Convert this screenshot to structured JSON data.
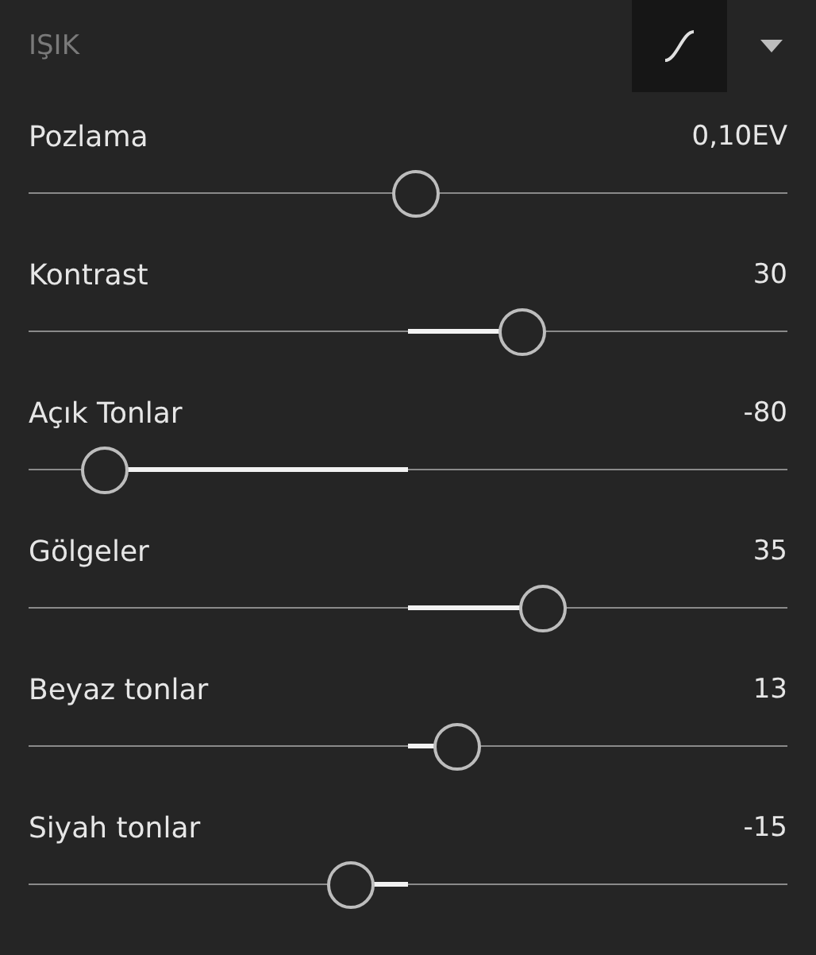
{
  "panel": {
    "title": "IŞIK",
    "curve_button": {
      "selected": true
    }
  },
  "sliders": [
    {
      "label": "Pozlama",
      "reading": "0,10EV",
      "level": 0.51
    },
    {
      "label": "Kontrast",
      "reading": "30",
      "level": 0.65
    },
    {
      "label": "Açık Tonlar",
      "reading": "-80",
      "level": 0.1
    },
    {
      "label": "Gölgeler",
      "reading": "35",
      "level": 0.678
    },
    {
      "label": "Beyaz tonlar",
      "reading": "13",
      "level": 0.565
    },
    {
      "label": "Siyah tonlar",
      "reading": "-15",
      "level": 0.425
    }
  ]
}
